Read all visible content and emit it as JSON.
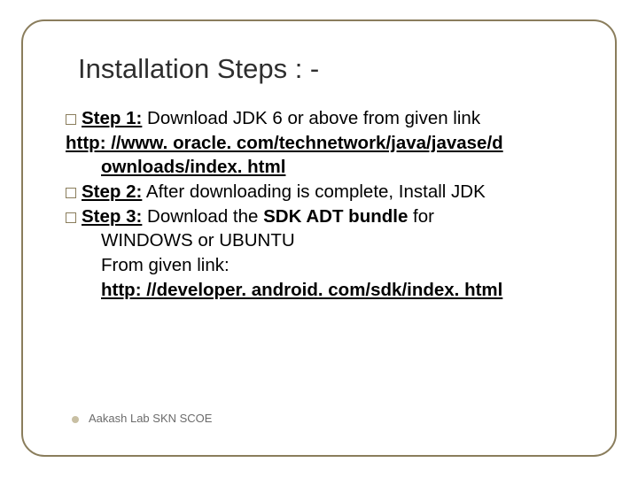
{
  "title": "Installation Steps : -",
  "step1_label": "Step 1:",
  "step1_text": " Download JDK 6 or above from given link",
  "link1a": " http: //www. oracle. com/technetwork/java/javase/d",
  "link1b": "ownloads/index. html",
  "step2_label": "Step 2:",
  "step2_text": " After downloading is complete, Install JDK",
  "step3_label": "Step 3:",
  "step3_text_a": " Download the ",
  "step3_bold": "SDK ADT bundle",
  "step3_text_b": " for",
  "step3_line2": "WINDOWS or UBUNTU",
  "step3_line3": "From given link:",
  "link2": "http: //developer. android. com/sdk/index. html",
  "footer": "Aakash Lab SKN SCOE"
}
